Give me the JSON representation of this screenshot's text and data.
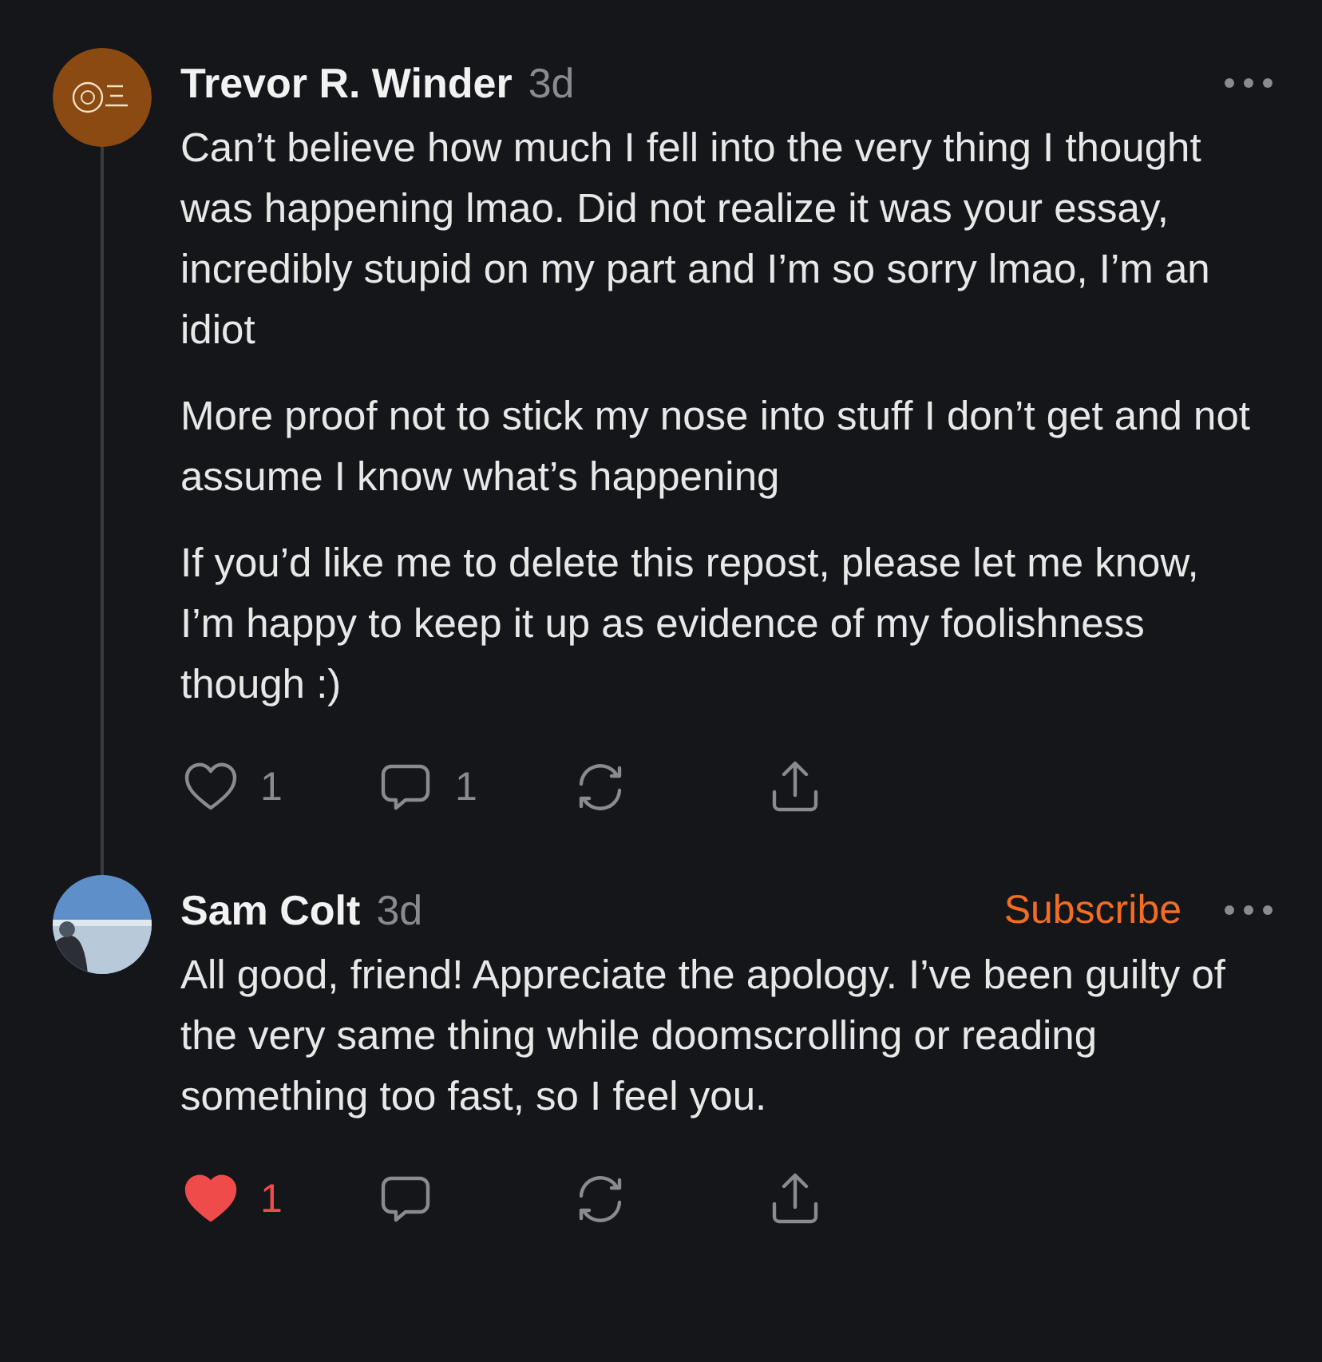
{
  "comments": [
    {
      "author": "Trevor R. Winder",
      "time": "3d",
      "avatar": {
        "kind": "logo"
      },
      "paragraphs": [
        "Can’t believe how much I fell into the very thing I thought was happening lmao. Did not realize it was your essay, incredibly stupid on my part and I’m so sorry lmao, I’m an idiot",
        "More proof not to stick my nose into stuff I don’t get and not assume I know what’s happening",
        "If you’d like me to delete this repost, please let me know, I’m happy to keep it up as evidence of my foolishness though :)"
      ],
      "likes": "1",
      "liked": false,
      "replies": "1",
      "thread": true
    },
    {
      "author": "Sam Colt",
      "time": "3d",
      "avatar": {
        "kind": "picture"
      },
      "subscribe": "Subscribe",
      "paragraphs": [
        "All good, friend! Appreciate the apology. I’ve been guilty of the very same thing while doomscrolling or reading something too fast, so I feel you."
      ],
      "likes": "1",
      "liked": true,
      "thread": false
    }
  ]
}
